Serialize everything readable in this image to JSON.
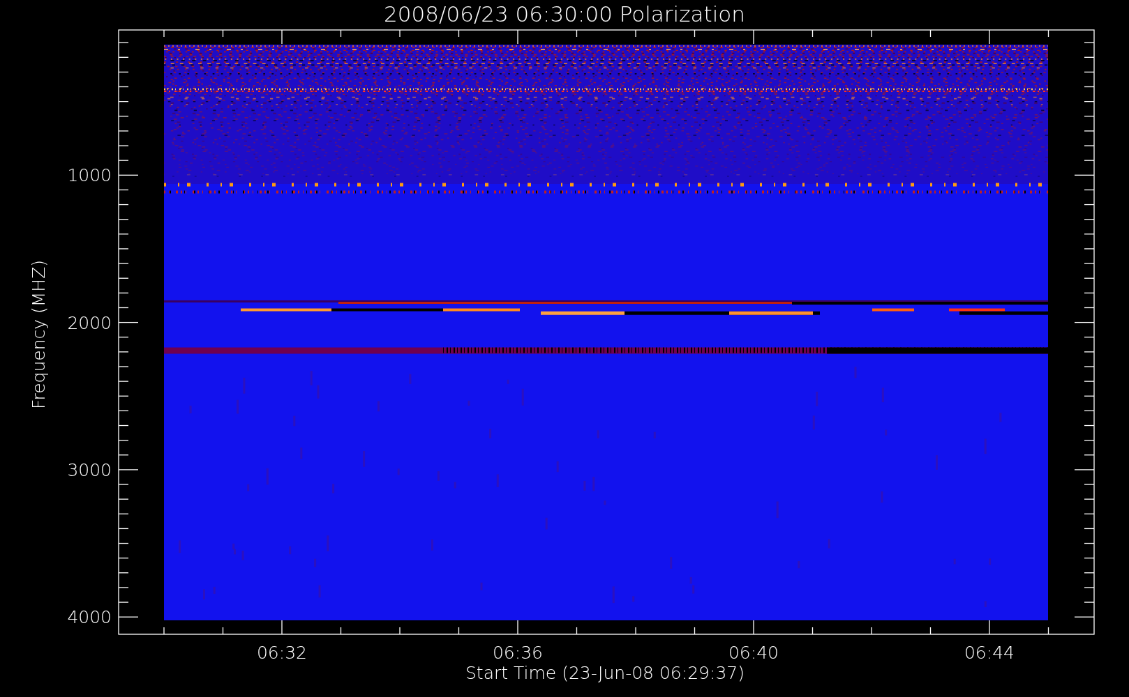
{
  "title": "2008/06/23 06:30:00 Polarization",
  "y_axis": {
    "label": "Frequency (MHZ)",
    "ticks": [
      "1000",
      "2000",
      "3000",
      "4000"
    ]
  },
  "x_axis": {
    "label": "Start Time (23-Jun-08 06:29:37)",
    "ticks": [
      "06:32",
      "06:36",
      "06:40",
      "06:44"
    ]
  }
}
